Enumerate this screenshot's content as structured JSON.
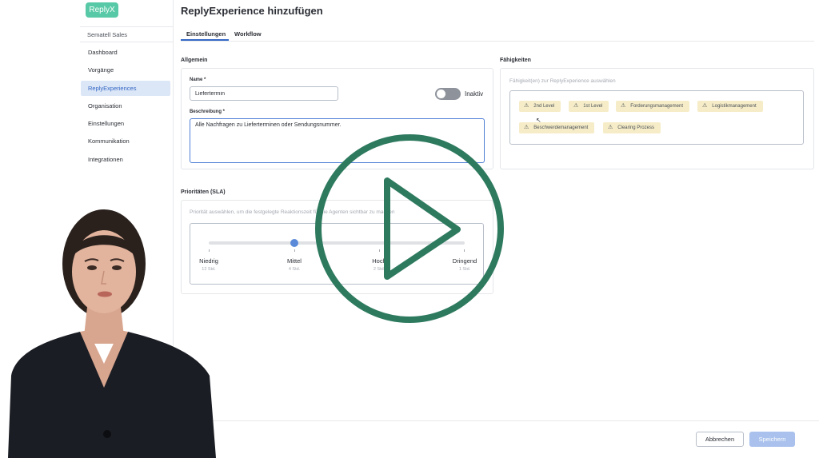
{
  "app": {
    "logo": "ReplyX",
    "workspace": "Sematell Sales"
  },
  "sidebar": {
    "items": [
      {
        "label": "Dashboard",
        "active": false
      },
      {
        "label": "Vorgänge",
        "active": false
      },
      {
        "label": "ReplyExperiences",
        "active": true
      },
      {
        "label": "Organisation",
        "active": false
      },
      {
        "label": "Einstellungen",
        "active": false
      },
      {
        "label": "Kommunikation",
        "active": false
      },
      {
        "label": "Integrationen",
        "active": false
      }
    ]
  },
  "page": {
    "title": "ReplyExperience hinzufügen"
  },
  "tabs": [
    {
      "label": "Einstellungen",
      "active": true
    },
    {
      "label": "Workflow",
      "active": false
    }
  ],
  "general": {
    "section_label": "Allgemein",
    "name_label": "Name *",
    "name_value": "Liefertermin",
    "toggle_label": "Inaktiv",
    "toggle_on": false,
    "description_label": "Beschreibung *",
    "description_value": "Alle Nachfragen zu Lieferterminen oder Sendungsnummer."
  },
  "skills": {
    "section_label": "Fähigkeiten",
    "hint": "Fähigkeit(en) zur ReplyExperience auswählen",
    "chips": [
      "2nd Level",
      "1st Level",
      "Forderungsmanagement",
      "Logistikmanagement",
      "Beschwerdemanagement",
      "Clearing Prozess"
    ]
  },
  "priorities": {
    "section_label": "Prioritäten (SLA)",
    "hint": "Priorität auswählen, um die festgelegte Reaktionszeit für die Agenten sichtbar zu machen",
    "levels": [
      {
        "name": "Niedrig",
        "time": "12 Std."
      },
      {
        "name": "Mittel",
        "time": "4 Std."
      },
      {
        "name": "Hoch",
        "time": "2 Std."
      },
      {
        "name": "Dringend",
        "time": "1 Std."
      }
    ],
    "selected_index": 1
  },
  "footer": {
    "cancel_label": "Abbrechen",
    "save_label": "Speichern"
  },
  "colors": {
    "accent": "#3568c4",
    "brand": "#58c9a6",
    "play": "#2e7a5f",
    "chip_bg": "#f6edc8"
  }
}
